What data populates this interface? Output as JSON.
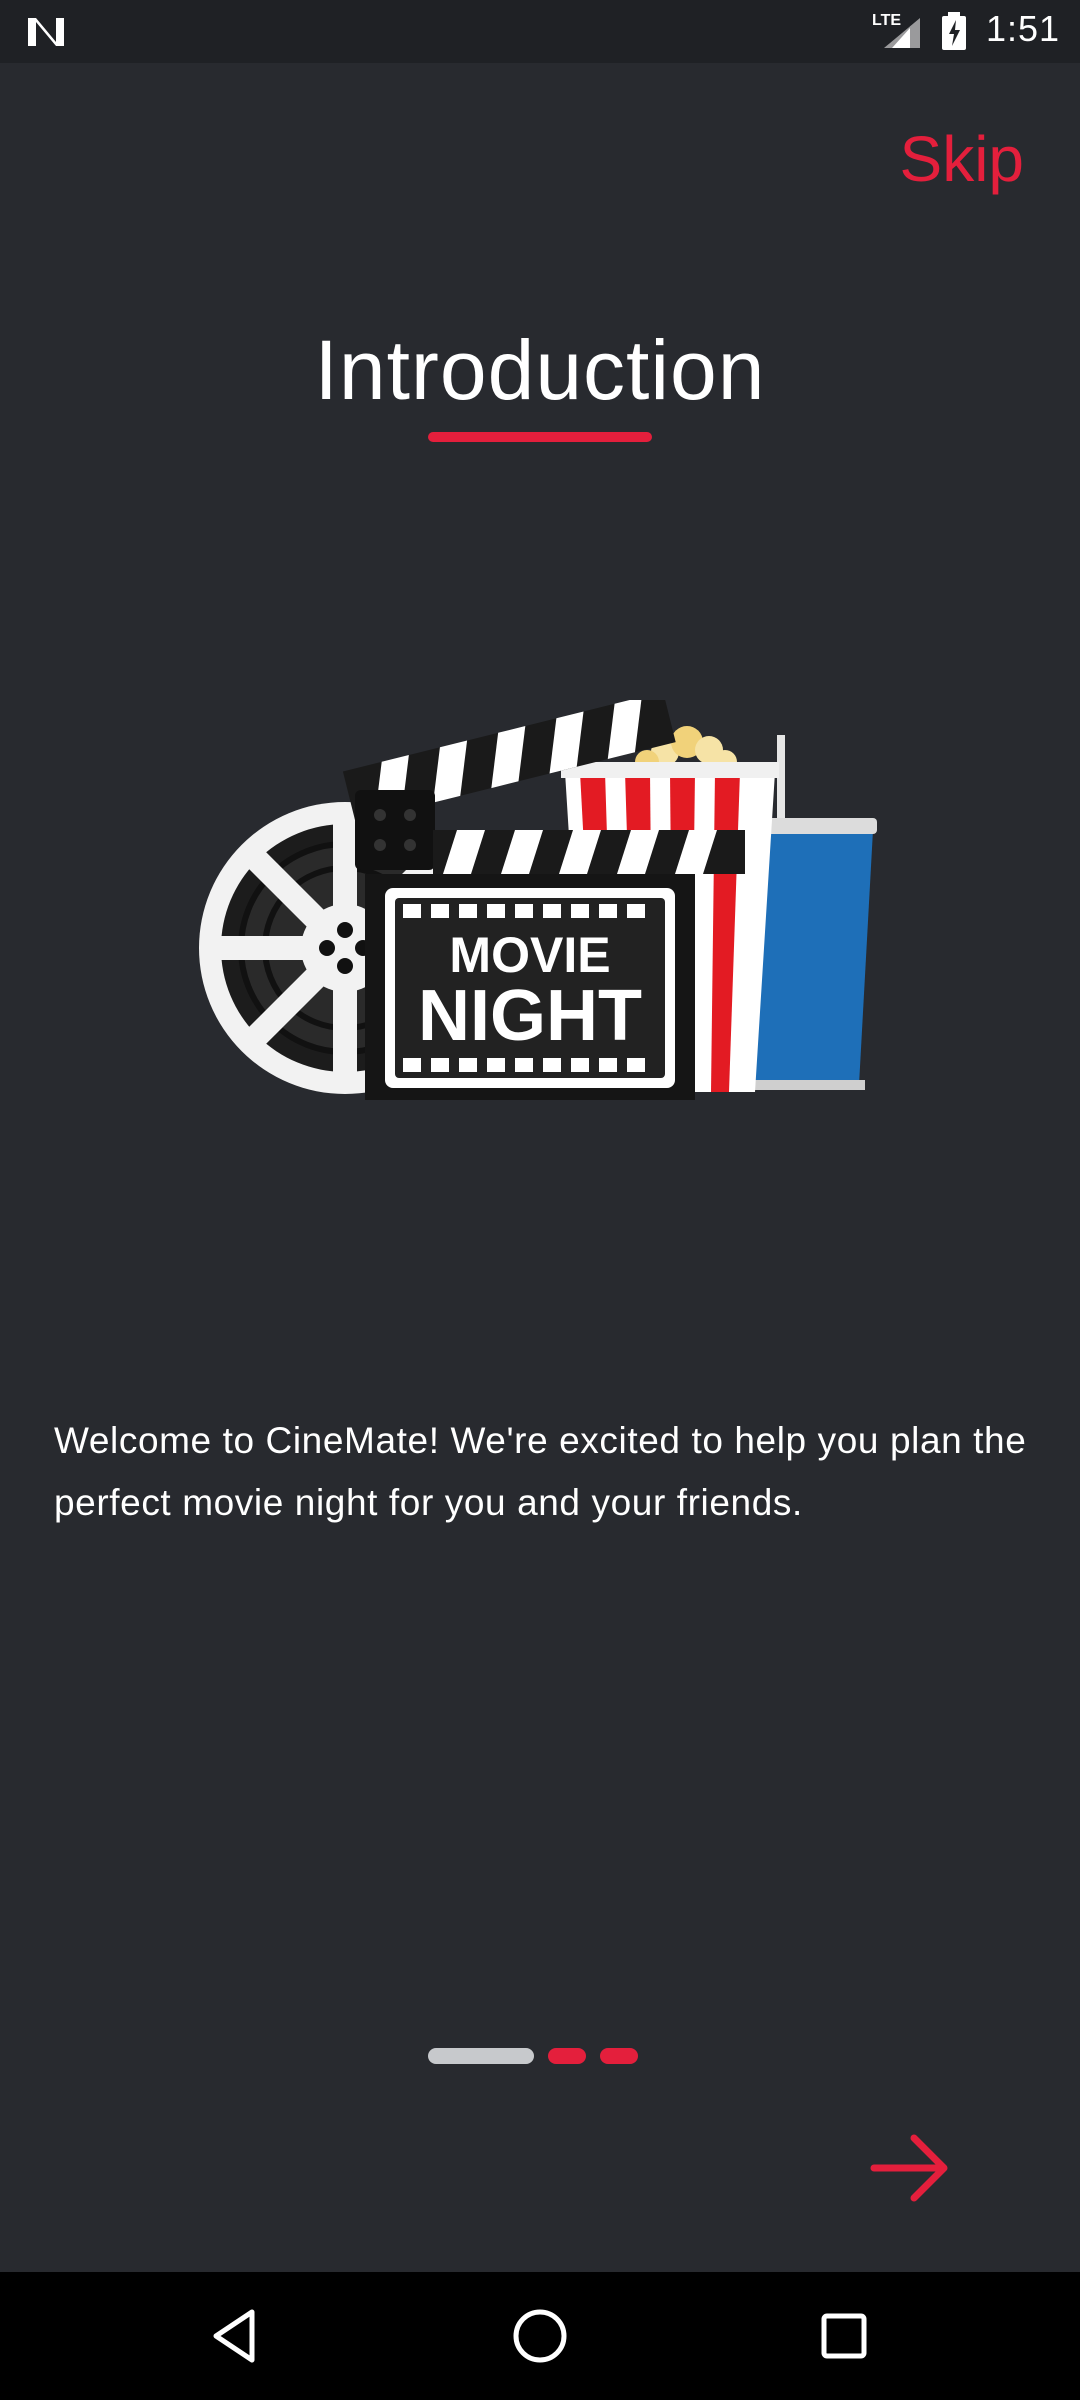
{
  "status_bar": {
    "time": "1:51",
    "network": "LTE",
    "icons": [
      "n-logo-icon",
      "lte-signal-icon",
      "battery-charging-icon"
    ]
  },
  "onboarding": {
    "skip_label": "Skip",
    "title": "Introduction",
    "illustration_text_line1": "MOVIE",
    "illustration_text_line2": "NIGHT",
    "description": "Welcome to CineMate! We're excited to help you plan the perfect movie night for you and your friends.",
    "pager": {
      "total_pages": 3,
      "current_page": 1
    },
    "next_icon": "arrow-right-icon"
  },
  "nav_bar": {
    "icons": [
      "back-icon",
      "home-icon",
      "recents-icon"
    ]
  },
  "colors": {
    "background": "#282a2f",
    "accent": "#e41f3c",
    "text": "#ffffff",
    "active_dot": "#c7c9cc"
  }
}
